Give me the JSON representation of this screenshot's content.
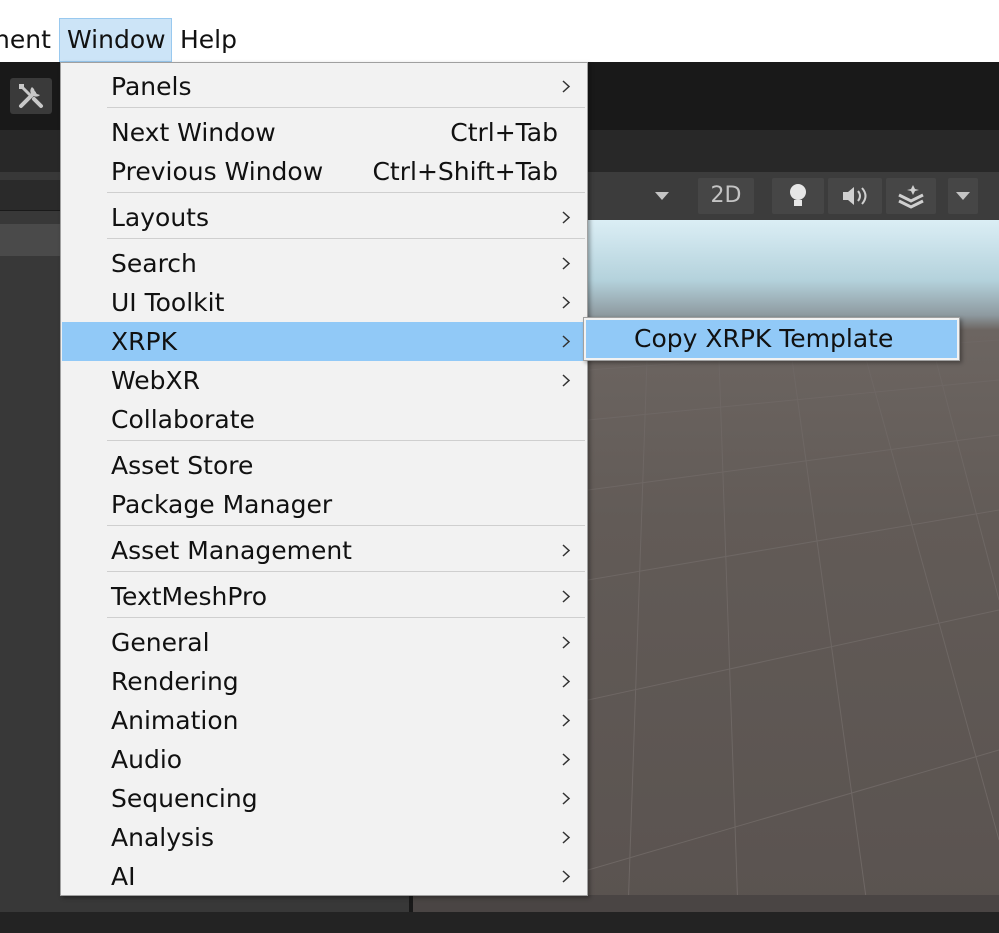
{
  "menubar": {
    "items": [
      {
        "label": "nent"
      },
      {
        "label": "Window"
      },
      {
        "label": "Help"
      }
    ]
  },
  "scene_toolbar": {
    "mode_2d_label": "2D"
  },
  "window_menu": {
    "items": [
      {
        "label": "Panels",
        "shortcut": "",
        "submenu": true
      },
      {
        "label": "Next Window",
        "shortcut": "Ctrl+Tab",
        "submenu": false
      },
      {
        "label": "Previous Window",
        "shortcut": "Ctrl+Shift+Tab",
        "submenu": false
      },
      {
        "label": "Layouts",
        "shortcut": "",
        "submenu": true
      },
      {
        "label": "Search",
        "shortcut": "",
        "submenu": true
      },
      {
        "label": "UI Toolkit",
        "shortcut": "",
        "submenu": true
      },
      {
        "label": "XRPK",
        "shortcut": "",
        "submenu": true
      },
      {
        "label": "WebXR",
        "shortcut": "",
        "submenu": true
      },
      {
        "label": "Collaborate",
        "shortcut": "",
        "submenu": false
      },
      {
        "label": "Asset Store",
        "shortcut": "",
        "submenu": false
      },
      {
        "label": "Package Manager",
        "shortcut": "",
        "submenu": false
      },
      {
        "label": "Asset Management",
        "shortcut": "",
        "submenu": true
      },
      {
        "label": "TextMeshPro",
        "shortcut": "",
        "submenu": true
      },
      {
        "label": "General",
        "shortcut": "",
        "submenu": true
      },
      {
        "label": "Rendering",
        "shortcut": "",
        "submenu": true
      },
      {
        "label": "Animation",
        "shortcut": "",
        "submenu": true
      },
      {
        "label": "Audio",
        "shortcut": "",
        "submenu": true
      },
      {
        "label": "Sequencing",
        "shortcut": "",
        "submenu": true
      },
      {
        "label": "Analysis",
        "shortcut": "",
        "submenu": true
      },
      {
        "label": "AI",
        "shortcut": "",
        "submenu": true
      }
    ],
    "active_item": "XRPK"
  },
  "xrpk_submenu": {
    "items": [
      {
        "label": "Copy XRPK Template"
      }
    ]
  },
  "icons": {
    "tools": "tools-icon",
    "chevron": "chevron-right-icon",
    "light": "lightbulb-icon",
    "audio": "speaker-icon",
    "effects": "layers-icon",
    "dropdown": "caret-down-icon"
  },
  "colors": {
    "highlight": "#91c9f7",
    "menubar_active": "#cce4f7",
    "menu_bg": "#f2f2f2"
  }
}
